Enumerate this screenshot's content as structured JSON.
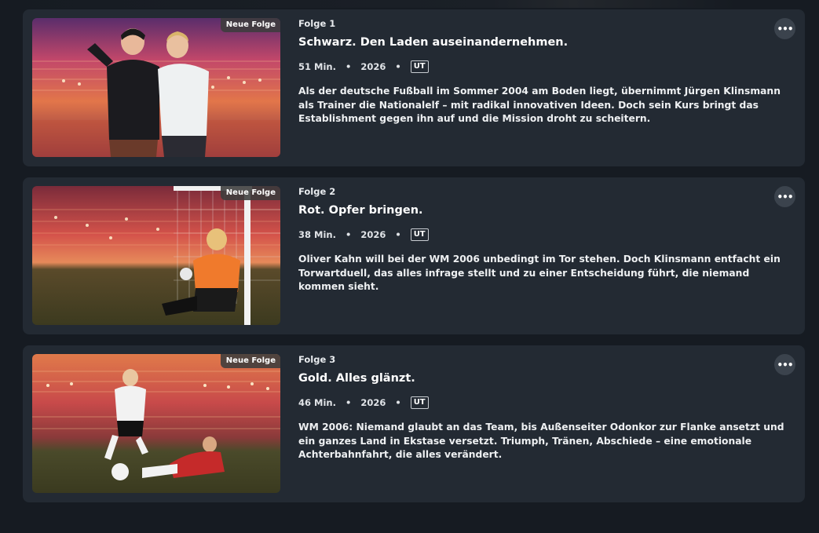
{
  "badge_label": "Neue Folge",
  "episodes": [
    {
      "number": "Folge 1",
      "title": "Schwarz. Den Laden auseinandernehmen.",
      "duration": "51 Min.",
      "year": "2026",
      "subtitle_badge": "UT",
      "description": "Als der deutsche Fußball im Sommer 2004 am Boden liegt, übernimmt Jürgen Klinsmann als Trainer die Nationalelf – mit radikal innovativen Ideen. Doch sein Kurs bringt das Establishment gegen ihn auf und die Mission droht zu scheitern."
    },
    {
      "number": "Folge 2",
      "title": "Rot. Opfer bringen.",
      "duration": "38 Min.",
      "year": "2026",
      "subtitle_badge": "UT",
      "description": "Oliver Kahn will bei der WM 2006 unbedingt im Tor stehen. Doch Klinsmann entfacht ein Torwartduell, das alles infrage stellt und zu einer Entscheidung führt, die niemand kommen sieht."
    },
    {
      "number": "Folge 3",
      "title": "Gold. Alles glänzt.",
      "duration": "46 Min.",
      "year": "2026",
      "subtitle_badge": "UT",
      "description": "WM 2006: Niemand glaubt an das Team, bis Außenseiter Odonkor zur Flanke ansetzt und ein ganzes Land in Ekstase versetzt. Triumph, Tränen, Abschiede – eine emotionale Achterbahnfahrt, die alles verändert."
    }
  ],
  "icons": {
    "more": "more-horizontal-icon"
  },
  "colors": {
    "card": "#232a33",
    "background": "#161b22"
  }
}
